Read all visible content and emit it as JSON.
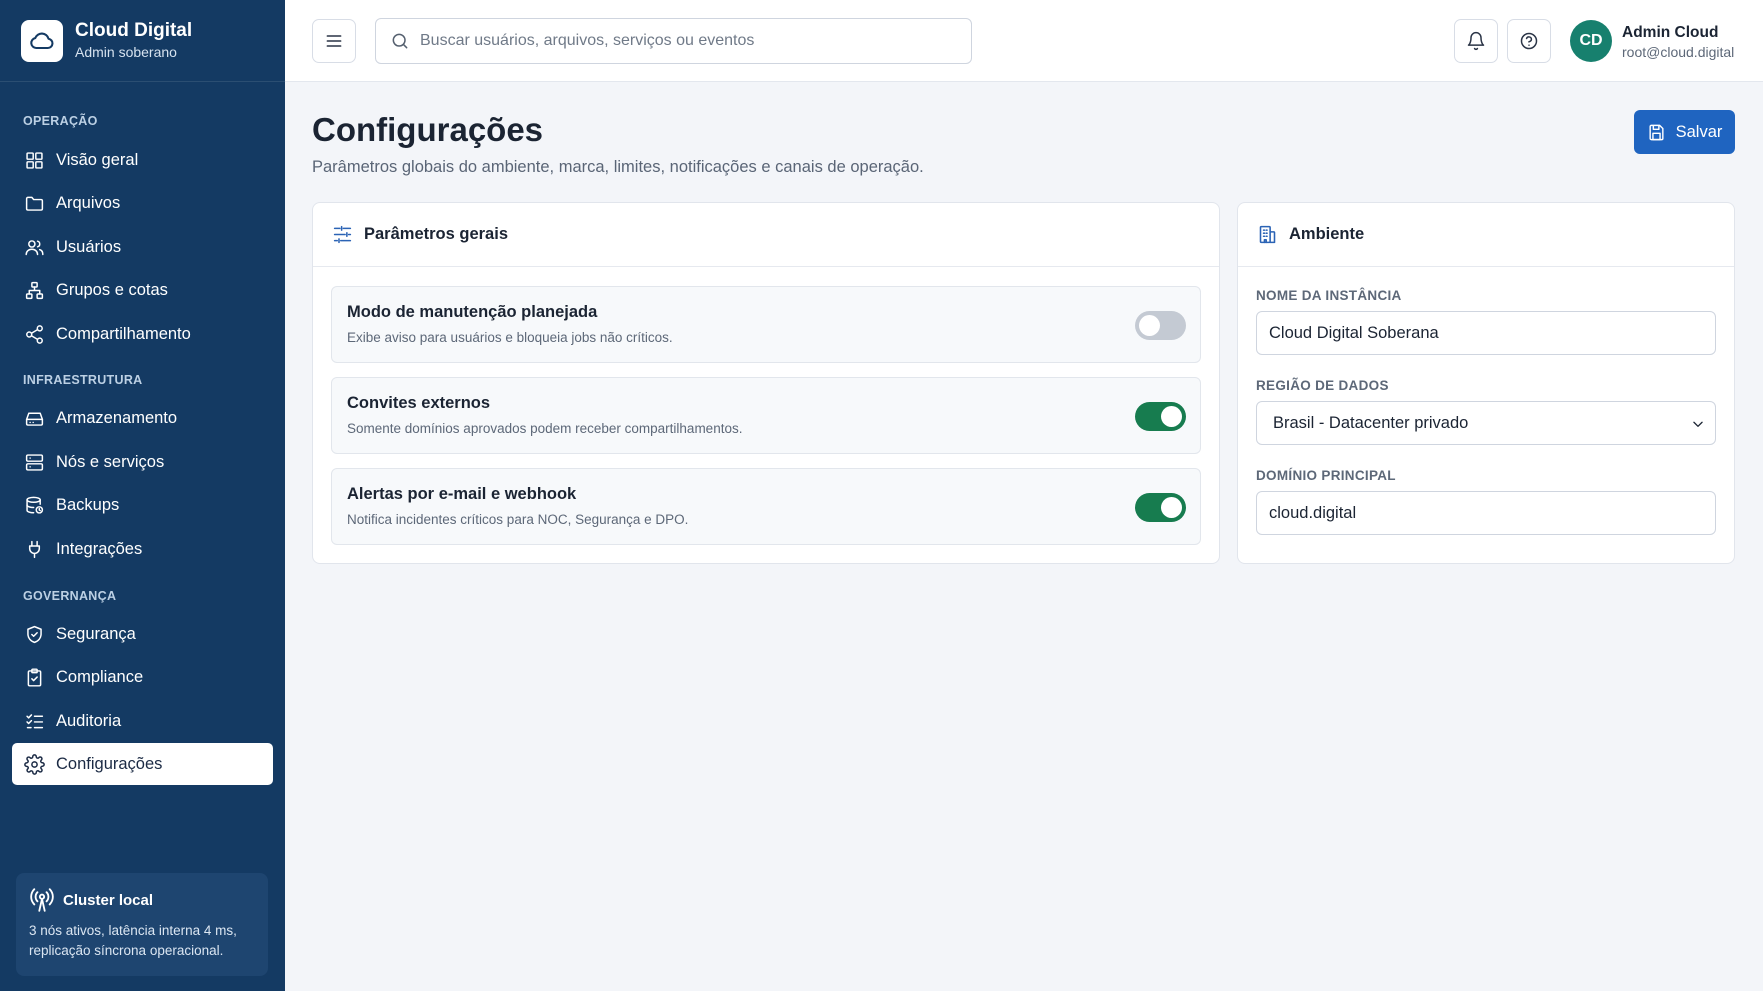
{
  "brand": {
    "name": "Cloud Digital",
    "subtitle": "Admin soberano"
  },
  "sidebar": {
    "sections": [
      {
        "title": "OPERAÇÃO",
        "items": [
          {
            "label": "Visão geral",
            "icon": "grid-icon"
          },
          {
            "label": "Arquivos",
            "icon": "folder-icon"
          },
          {
            "label": "Usuários",
            "icon": "users-icon"
          },
          {
            "label": "Grupos e cotas",
            "icon": "network-icon"
          },
          {
            "label": "Compartilhamento",
            "icon": "share-icon"
          }
        ]
      },
      {
        "title": "INFRAESTRUTURA",
        "items": [
          {
            "label": "Armazenamento",
            "icon": "hard-drive-icon"
          },
          {
            "label": "Nós e serviços",
            "icon": "server-icon"
          },
          {
            "label": "Backups",
            "icon": "database-backup-icon"
          },
          {
            "label": "Integrações",
            "icon": "plug-icon"
          }
        ]
      },
      {
        "title": "GOVERNANÇA",
        "items": [
          {
            "label": "Segurança",
            "icon": "shield-icon"
          },
          {
            "label": "Compliance",
            "icon": "clipboard-check-icon"
          },
          {
            "label": "Auditoria",
            "icon": "list-checks-icon"
          },
          {
            "label": "Configurações",
            "icon": "gear-icon",
            "active": true
          }
        ]
      }
    ],
    "cluster": {
      "title": "Cluster local",
      "text": "3 nós ativos, latência interna 4 ms, replicação síncrona operacional."
    }
  },
  "header": {
    "search_placeholder": "Buscar usuários, arquivos, serviços ou eventos",
    "user": {
      "initials": "CD",
      "name": "Admin Cloud",
      "email": "root@cloud.digital"
    }
  },
  "page": {
    "title": "Configurações",
    "subtitle": "Parâmetros globais do ambiente, marca, limites, notificações e canais de operação.",
    "save_label": "Salvar"
  },
  "general": {
    "title": "Parâmetros gerais",
    "settings": [
      {
        "title": "Modo de manutenção planejada",
        "desc": "Exibe aviso para usuários e bloqueia jobs não críticos.",
        "enabled": false
      },
      {
        "title": "Convites externos",
        "desc": "Somente domínios aprovados podem receber compartilhamentos.",
        "enabled": true
      },
      {
        "title": "Alertas por e-mail e webhook",
        "desc": "Notifica incidentes críticos para NOC, Segurança e DPO.",
        "enabled": true
      }
    ]
  },
  "environment": {
    "title": "Ambiente",
    "instance_label": "NOME DA INSTÂNCIA",
    "instance_value": "Cloud Digital Soberana",
    "region_label": "REGIÃO DE DADOS",
    "region_value": "Brasil - Datacenter privado",
    "domain_label": "DOMÍNIO PRINCIPAL",
    "domain_value": "cloud.digital"
  },
  "colors": {
    "sidebar": "#143a63",
    "accent": "#1f64c0",
    "toggle_on": "#177c4f",
    "avatar": "#17806e"
  }
}
